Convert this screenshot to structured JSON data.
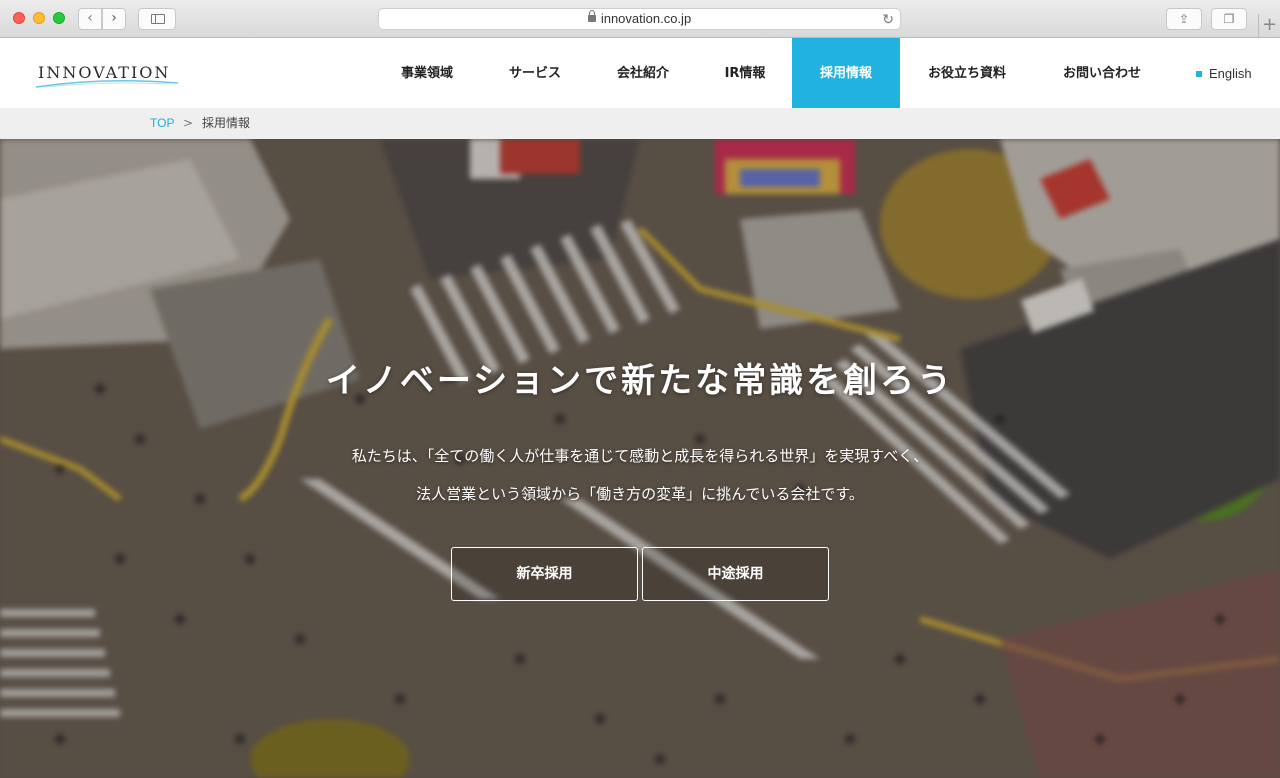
{
  "browser": {
    "url": "innovation.co.jp"
  },
  "header": {
    "logo_text": "INNOVATION",
    "nav": [
      {
        "label": "事業領域"
      },
      {
        "label": "サービス"
      },
      {
        "label": "会社紹介"
      },
      {
        "label": "IR情報"
      },
      {
        "label": "採用情報",
        "active": true
      },
      {
        "label": "お役立ち資料"
      },
      {
        "label": "お問い合わせ"
      }
    ],
    "lang_label": "English",
    "accent_color": "#22b2df"
  },
  "breadcrumb": {
    "top": "TOP",
    "separator": ">",
    "current": "採用情報"
  },
  "hero": {
    "title": "イノベーションで新たな常識を創ろう",
    "desc_line1": "私たちは、「全ての働く人が仕事を通じて感動と成長を得られる世界」を実現すべく、",
    "desc_line2": "法人営業という領域から「働き方の変革」に挑んでいる会社です。",
    "buttons": [
      {
        "label": "新卒採用"
      },
      {
        "label": "中途採用"
      }
    ]
  }
}
